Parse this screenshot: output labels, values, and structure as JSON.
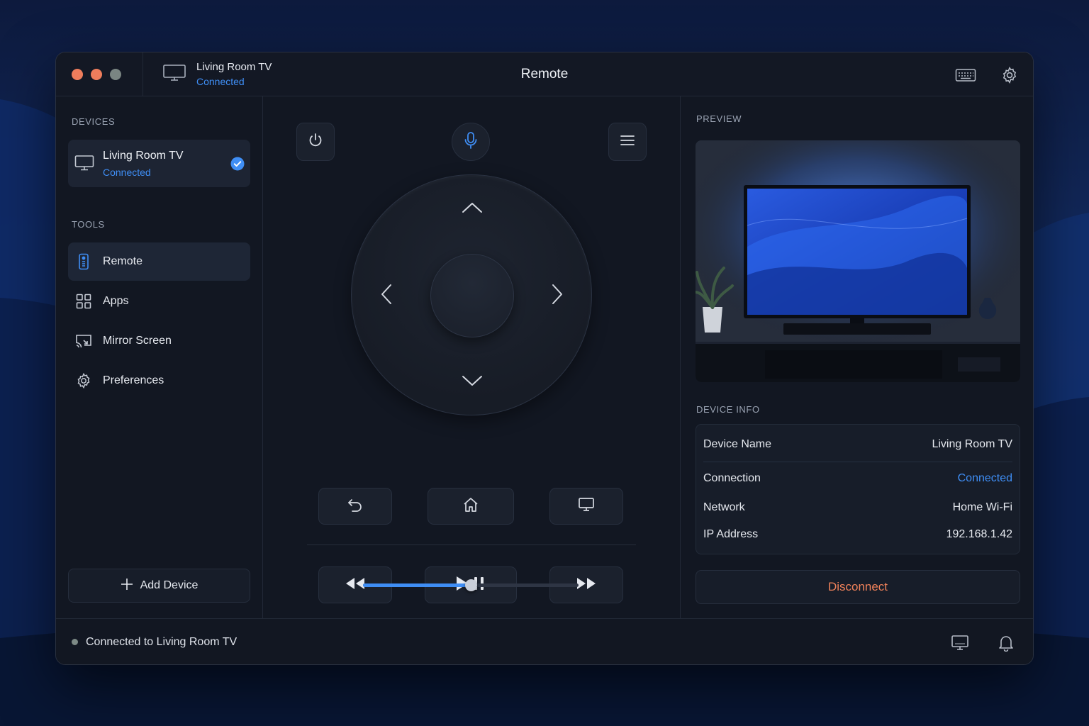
{
  "window": {
    "title": "Remote"
  },
  "titlebar": {
    "device_name": "Living Room TV",
    "device_status": "Connected",
    "keyboard_icon": "keyboard-icon",
    "settings_icon": "gear-icon"
  },
  "sidebar": {
    "devices_label": "DEVICES",
    "device_card": {
      "name": "Living Room TV",
      "status": "Connected",
      "selected": true
    },
    "tools_label": "TOOLS",
    "items": [
      {
        "label": "Remote",
        "icon": "remote-icon",
        "active": true
      },
      {
        "label": "Apps",
        "icon": "grid-icon",
        "active": false
      },
      {
        "label": "Mirror Screen",
        "icon": "mirror-screen-icon",
        "active": false
      },
      {
        "label": "Preferences",
        "icon": "gear-icon",
        "active": false
      }
    ],
    "add_device_label": "Add Device"
  },
  "remote": {
    "volume_level": 0.5
  },
  "preview": {
    "label": "PREVIEW"
  },
  "device_info": {
    "label": "DEVICE INFO",
    "rows": [
      {
        "key": "Device Name",
        "value": "Living Room TV"
      },
      {
        "key": "Connection",
        "value": "Connected"
      },
      {
        "key": "Network",
        "value": "Home Wi-Fi"
      },
      {
        "key": "IP Address",
        "value": "192.168.1.42"
      }
    ],
    "disconnect_label": "Disconnect"
  },
  "statusbar": {
    "text": "Connected to Living Room TV"
  },
  "colors": {
    "accent": "#3f8ef5",
    "danger": "#f0825a",
    "window_bg": "#121722"
  }
}
